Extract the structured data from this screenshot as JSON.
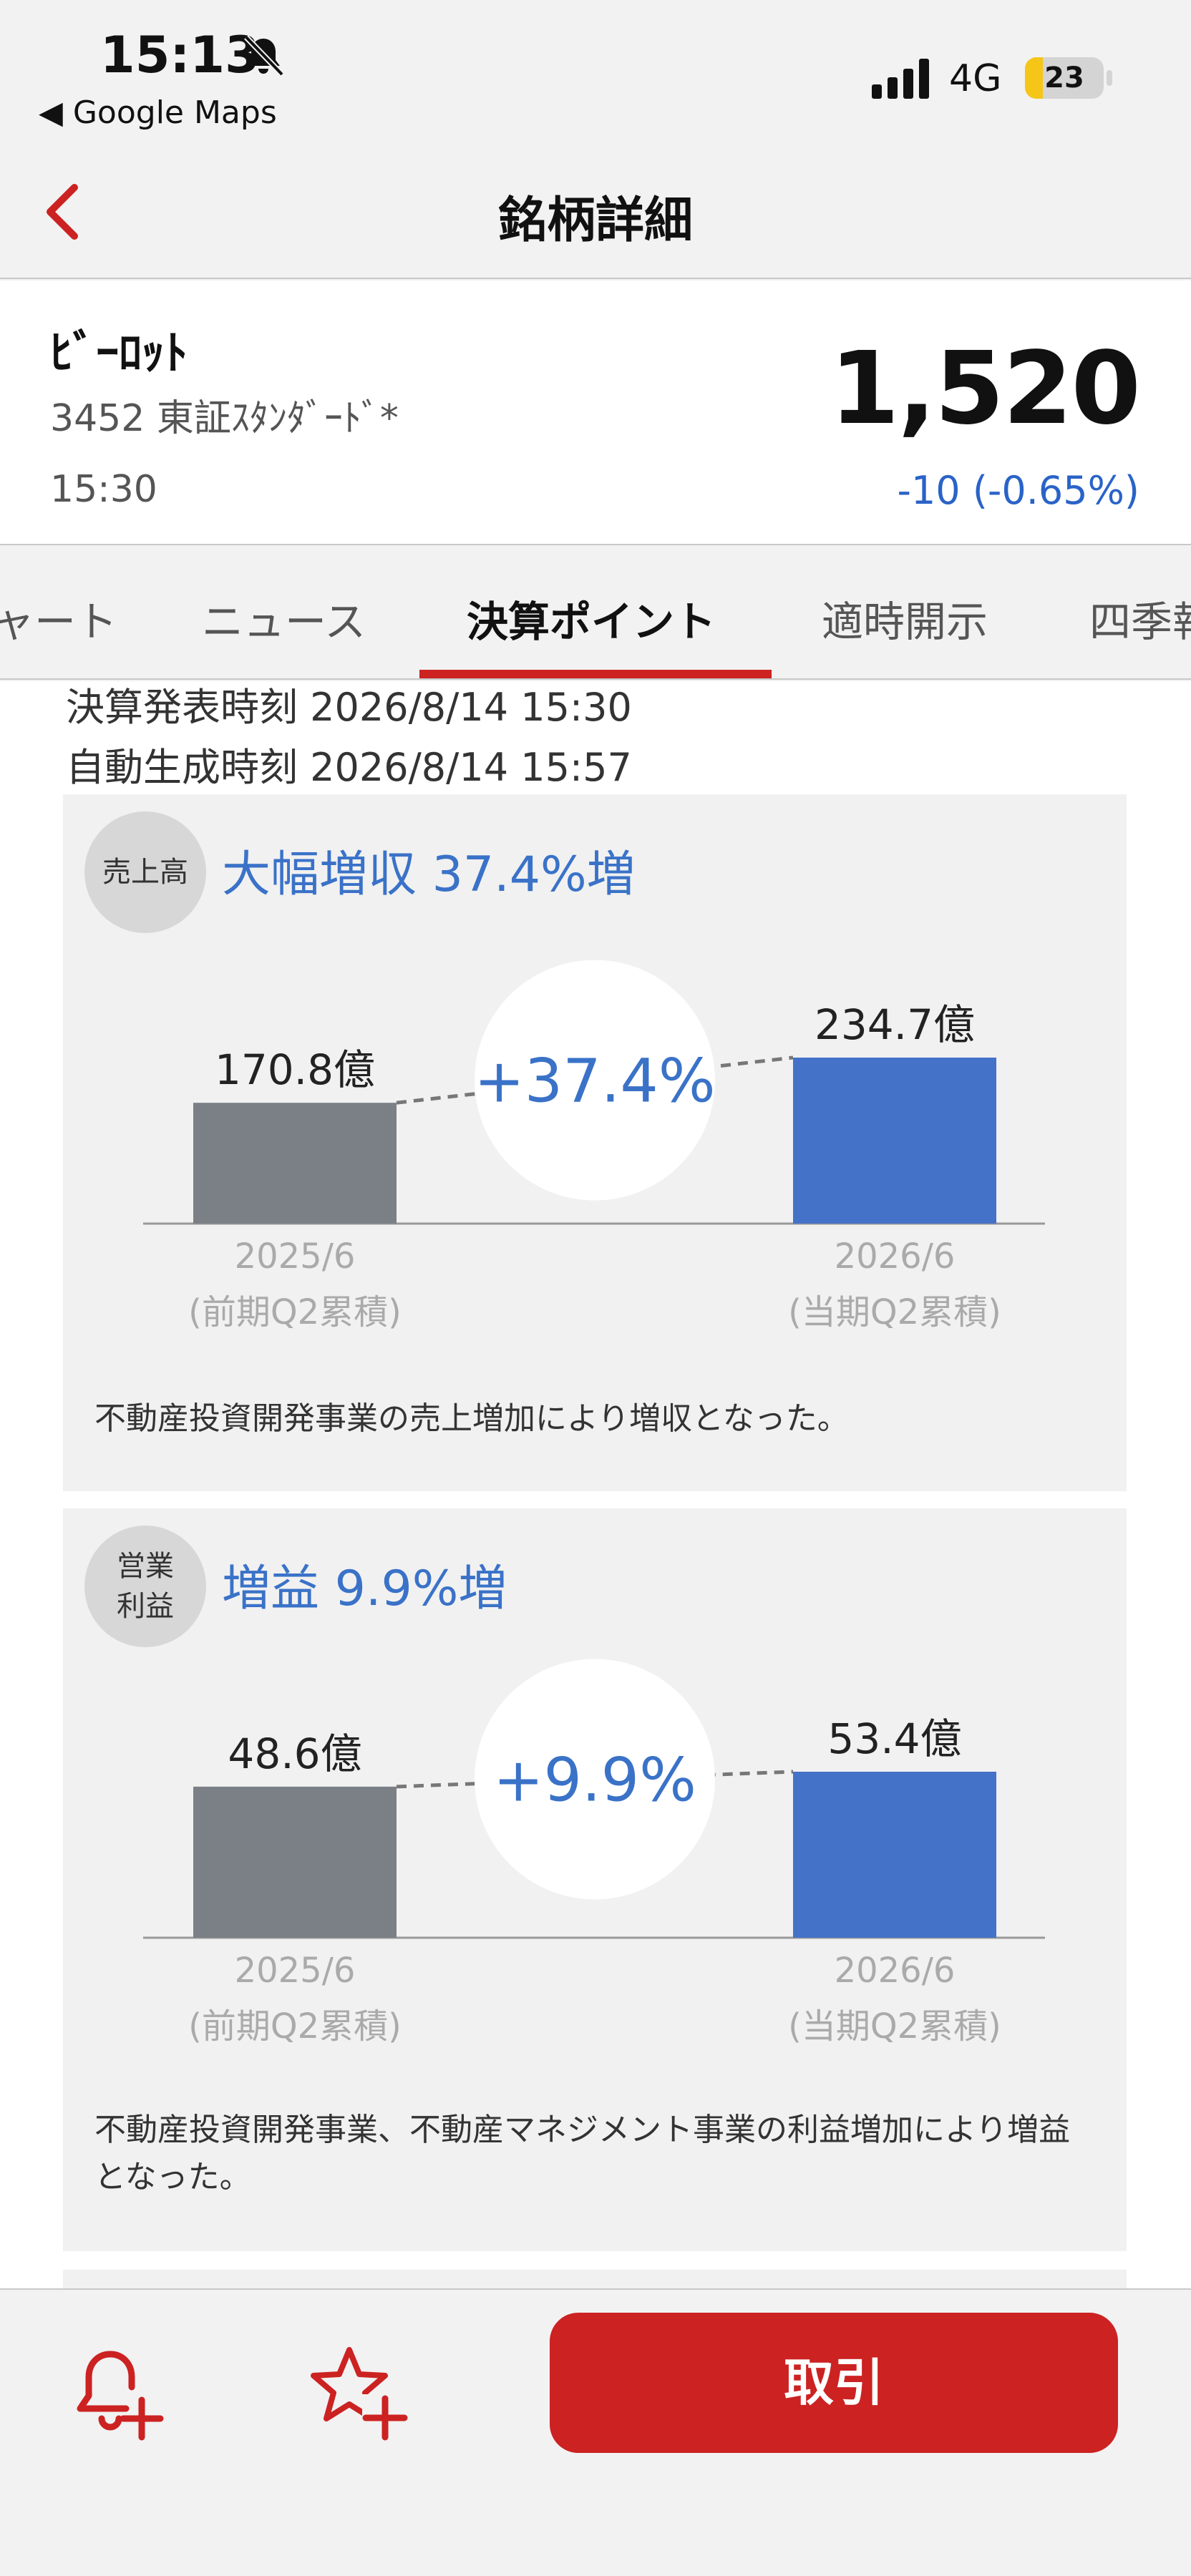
{
  "status_bar": {
    "time": "15:13",
    "back_app": "◀ Google Maps",
    "network": "4G",
    "battery_level": "23",
    "battery_fraction": 0.23,
    "silent_icon": "bell-slash-icon",
    "signal_icon": "signal-bars-icon"
  },
  "nav": {
    "title": "銘柄詳細",
    "back_icon": "chevron-left-icon"
  },
  "stock": {
    "name": "ﾋﾞｰﾛｯﾄ",
    "code_market": "3452  東証ｽﾀﾝﾀﾞｰﾄﾞ*",
    "time": "15:30",
    "price": "1,520",
    "change": "-10 (-0.65%)"
  },
  "tabs": {
    "items": [
      "ャート",
      "ニュース",
      "決算ポイント",
      "適時開示",
      "四季報"
    ],
    "active": "決算ポイント"
  },
  "report": {
    "announce_time": "決算発表時刻 2026/8/14 15:30",
    "generated_time": "自動生成時刻 2026/8/14 15:57"
  },
  "cards": [
    {
      "badge_line1": "売上高",
      "badge_line2": "",
      "headline": "大幅増収 37.4%増",
      "prev_value_label": "170.8億",
      "curr_value_label": "234.7億",
      "change_label": "+37.4%",
      "prev_period": "2025/6",
      "prev_sub": "(前期Q2累積)",
      "curr_period": "2026/6",
      "curr_sub": "(当期Q2累積)",
      "comment": "不動産投資開発事業の売上増加により増収となった。"
    },
    {
      "badge_line1": "営業",
      "badge_line2": "利益",
      "headline": "増益 9.9%増",
      "prev_value_label": "48.6億",
      "curr_value_label": "53.4億",
      "change_label": "+9.9%",
      "prev_period": "2025/6",
      "prev_sub": "(前期Q2累積)",
      "curr_period": "2026/6",
      "curr_sub": "(当期Q2累積)",
      "comment": "不動産投資開発事業、不動産マネジメント事業の利益増加により増益となった。"
    }
  ],
  "chart_data": [
    {
      "type": "bar",
      "categories": [
        "2025/6 (前期Q2累積)",
        "2026/6 (当期Q2累積)"
      ],
      "values": [
        170.8,
        234.7
      ],
      "title": "大幅増収 37.4%増",
      "unit": "億",
      "colors": [
        "#7b7f86",
        "#4472c8"
      ]
    },
    {
      "type": "bar",
      "categories": [
        "2025/6 (前期Q2累積)",
        "2026/6 (当期Q2累積)"
      ],
      "values": [
        48.6,
        53.4
      ],
      "title": "増益 9.9%増",
      "unit": "億",
      "colors": [
        "#7b7f86",
        "#4472c8"
      ]
    }
  ],
  "bottom_bar": {
    "alert_icon": "bell-plus-icon",
    "favorite_icon": "star-plus-icon",
    "trade_label": "取引"
  },
  "colors": {
    "accent_red": "#cc2222",
    "price_change_blue": "#2a63c8",
    "headline_blue": "#3a72c8",
    "prev_bar": "#7b7f86",
    "curr_bar": "#4472c8"
  }
}
